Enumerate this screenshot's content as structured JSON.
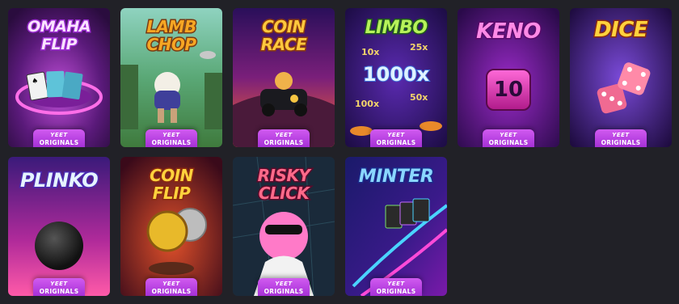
{
  "badge": {
    "line1": "YEET",
    "line2": "ORIGINALS"
  },
  "games": [
    {
      "title": "OMAHA\nFLIP"
    },
    {
      "title": "LAMB\nCHOP"
    },
    {
      "title": "COIN\nRACE"
    },
    {
      "title": "LIMBO",
      "multipliers": [
        "10x",
        "25x",
        "1000x",
        "100x",
        "50x"
      ]
    },
    {
      "title": "KENO",
      "number": "10"
    },
    {
      "title": "DICE"
    },
    {
      "title": "PLINKO"
    },
    {
      "title": "COIN\nFLIP"
    },
    {
      "title": "RISKY\nCLICK"
    },
    {
      "title": "MINTER"
    }
  ]
}
